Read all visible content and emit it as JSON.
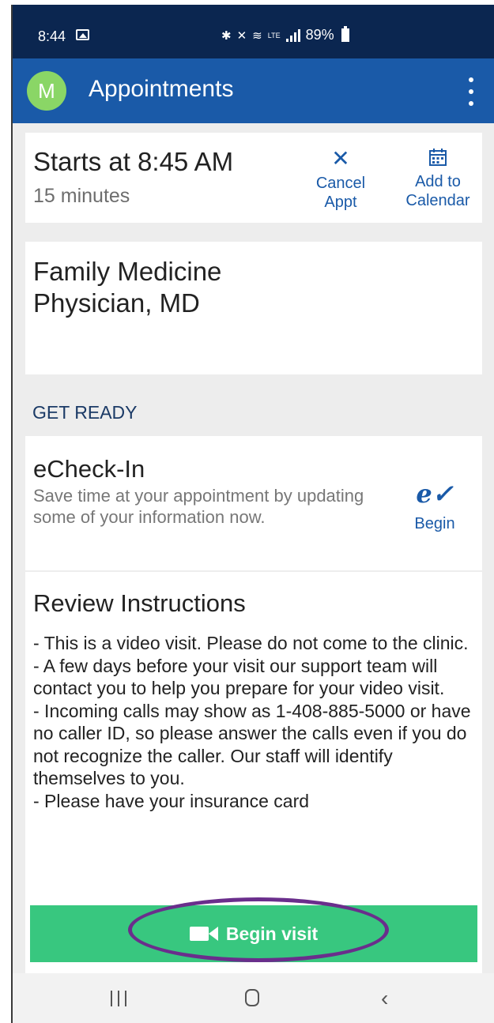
{
  "status_bar": {
    "time": "8:44",
    "battery": "89%",
    "icons": [
      "image-icon",
      "bluetooth-icon",
      "mute-icon",
      "wifi-icon",
      "lte-icon",
      "signal-icon",
      "battery-icon"
    ],
    "network_label": "LTE"
  },
  "app_bar": {
    "avatar_initial": "M",
    "title": "Appointments",
    "menu_icon": "more-vertical-icon"
  },
  "appointment": {
    "starts": "Starts at 8:45 AM",
    "duration": "15 minutes",
    "cancel_label_1": "Cancel",
    "cancel_label_2": "Appt",
    "calendar_label_1": "Add to",
    "calendar_label_2": "Calendar"
  },
  "provider": {
    "line1": "Family Medicine",
    "line2": "Physician, MD"
  },
  "get_ready": {
    "header": "GET READY"
  },
  "echeckin": {
    "title": "eCheck-In",
    "description": "Save time at your appointment by updating some of your information now.",
    "action_label": "Begin",
    "action_glyph": "e✓"
  },
  "instructions": {
    "title": "Review Instructions",
    "lines": [
      "- This is a video visit.  Please do not come to the clinic.",
      "- A few days before your visit our support team will contact you to help you prepare for your video visit.",
      "- Incoming calls may show as 1-408-885-5000 or have no caller ID, so please answer the calls even if you do not recognize the caller. Our staff will identify themselves to you.",
      "- Please have your insurance card"
    ]
  },
  "begin_visit": {
    "label": "Begin visit"
  },
  "colors": {
    "status_bar": "#0b2650",
    "app_bar": "#1a5aa8",
    "accent": "#1a5aa8",
    "avatar": "#8ad666",
    "begin_button": "#38c77f",
    "highlight_ring": "#6a2e8c",
    "page_background": "#ededed"
  },
  "nav_bar": {
    "icons": [
      "recents-icon",
      "home-icon",
      "back-icon"
    ]
  }
}
